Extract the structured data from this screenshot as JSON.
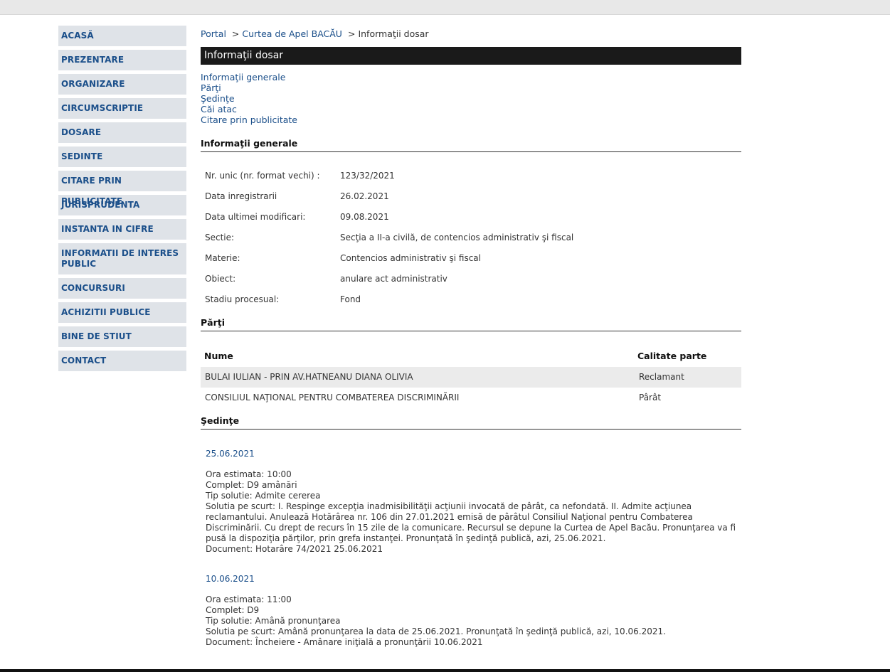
{
  "sidebar": {
    "items": [
      {
        "label": "ACASĂ"
      },
      {
        "label": "PREZENTARE"
      },
      {
        "label": "ORGANIZARE"
      },
      {
        "label": "CIRCUMSCRIPTIE"
      },
      {
        "label": "DOSARE"
      },
      {
        "label": "SEDINTE"
      },
      {
        "label": "CITARE PRIN PUBLICITATE"
      },
      {
        "label": "JURISPRUDENTA"
      },
      {
        "label": "INSTANTA IN CIFRE"
      },
      {
        "label": "INFORMATII DE INTERES PUBLIC"
      },
      {
        "label": "CONCURSURI"
      },
      {
        "label": "ACHIZITII PUBLICE"
      },
      {
        "label": "BINE DE STIUT"
      },
      {
        "label": "CONTACT"
      }
    ]
  },
  "breadcrumb": {
    "portal": "Portal",
    "separator": ">",
    "court": "Curtea de Apel BACĂU",
    "current": "Informaţii dosar"
  },
  "page_title": "Informaţii dosar",
  "anchors": {
    "general": "Informaţii generale",
    "parti": "Părţi",
    "sedinte": "Şedinţe",
    "cai_atac": "Căi atac",
    "citare": "Citare prin publicitate"
  },
  "general": {
    "heading": "Informaţii generale",
    "rows": [
      {
        "key": "Nr. unic (nr. format vechi) :",
        "value": "123/32/2021"
      },
      {
        "key": "Data inregistrarii",
        "value": "26.02.2021"
      },
      {
        "key": "Data ultimei modificari:",
        "value": "09.08.2021"
      },
      {
        "key": "Sectie:",
        "value": "Secţia a II-a civilă, de contencios administrativ şi fiscal"
      },
      {
        "key": "Materie:",
        "value": "Contencios administrativ şi fiscal"
      },
      {
        "key": "Obiect:",
        "value": "anulare act administrativ"
      },
      {
        "key": "Stadiu procesual:",
        "value": "Fond"
      }
    ]
  },
  "parti": {
    "heading": "Părţi",
    "col_name": "Nume",
    "col_role": "Calitate parte",
    "rows": [
      {
        "name": "BULAI IULIAN - PRIN AV.HATNEANU DIANA OLIVIA",
        "role": "Reclamant"
      },
      {
        "name": "CONSILIUL NAŢIONAL PENTRU COMBATEREA DISCRIMINĂRII",
        "role": "Pârât"
      }
    ]
  },
  "sedinte": {
    "heading": "Şedinţe",
    "items": [
      {
        "date": "25.06.2021",
        "ora": "Ora estimata: 10:00",
        "complet": "Complet: D9 amânări",
        "tip": "Tip solutie: Admite cererea",
        "solutie": "Solutia pe scurt: I. Respinge excepţia inadmisibilităţii acţiunii invocată de pârât, ca nefondată. II. Admite acţiunea reclamantului. Anulează Hotărârea nr. 106 din 27.01.2021 emisă de pârâtul Consiliul Naţional pentru Combaterea Discriminării. Cu drept de recurs în 15 zile de la comunicare. Recursul se depune la Curtea de Apel Bacău. Pronunţarea va fi pusă la dispoziţia părţilor, prin grefa instanţei. Pronunţată în şedinţă publică, azi, 25.06.2021.",
        "document": "Document: Hotarâre  74/2021  25.06.2021"
      },
      {
        "date": "10.06.2021",
        "ora": "Ora estimata: 11:00",
        "complet": "Complet: D9",
        "tip": "Tip solutie: Amână pronunţarea",
        "solutie": "Solutia pe scurt: Amână pronunţarea la data de 25.06.2021. Pronunţată în şedinţă publică, azi, 10.06.2021.",
        "document": "Document: Încheiere - Amânare iniţială a pronunţării    10.06.2021"
      }
    ]
  }
}
